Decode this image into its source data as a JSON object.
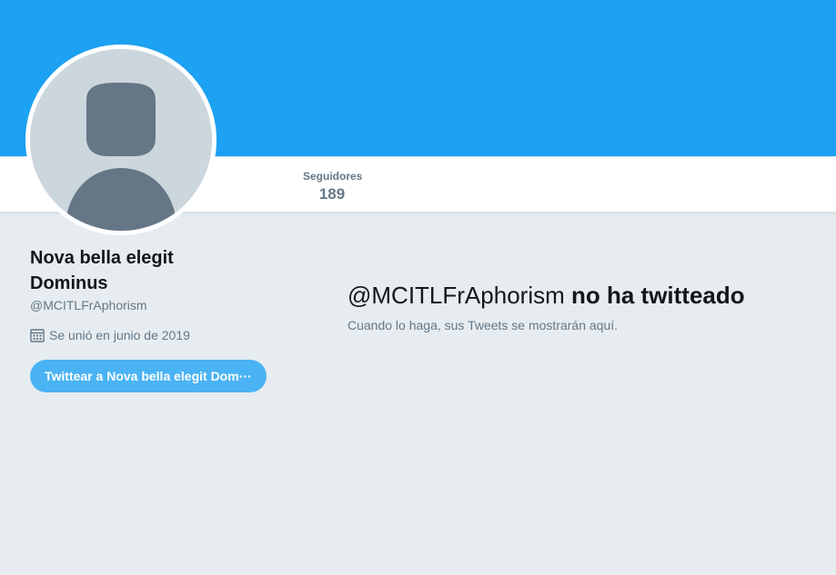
{
  "colors": {
    "banner": "#1da1f2",
    "background": "#e6ecf0",
    "button": "#4ab3f4",
    "secondary_text": "#657786",
    "avatar_bg": "#ccd6dd",
    "avatar_figure": "#657786"
  },
  "nav": {
    "followers_label": "Seguidores",
    "followers_count": "189"
  },
  "profile": {
    "name_line1": "Nova bella elegit",
    "name_line2": "Dominus",
    "screen_name": "@MCITLFrAphorism",
    "joined_icon": "calendar-icon",
    "joined_text": "Se unió en junio de 2019",
    "tweet_to_button": "Twittear a Nova bella elegit Dom···"
  },
  "empty_state": {
    "handle": "@MCITLFrAphorism",
    "title_rest": "no ha twitteado",
    "subtitle": "Cuando lo haga, sus Tweets se mostrarán aquí."
  }
}
